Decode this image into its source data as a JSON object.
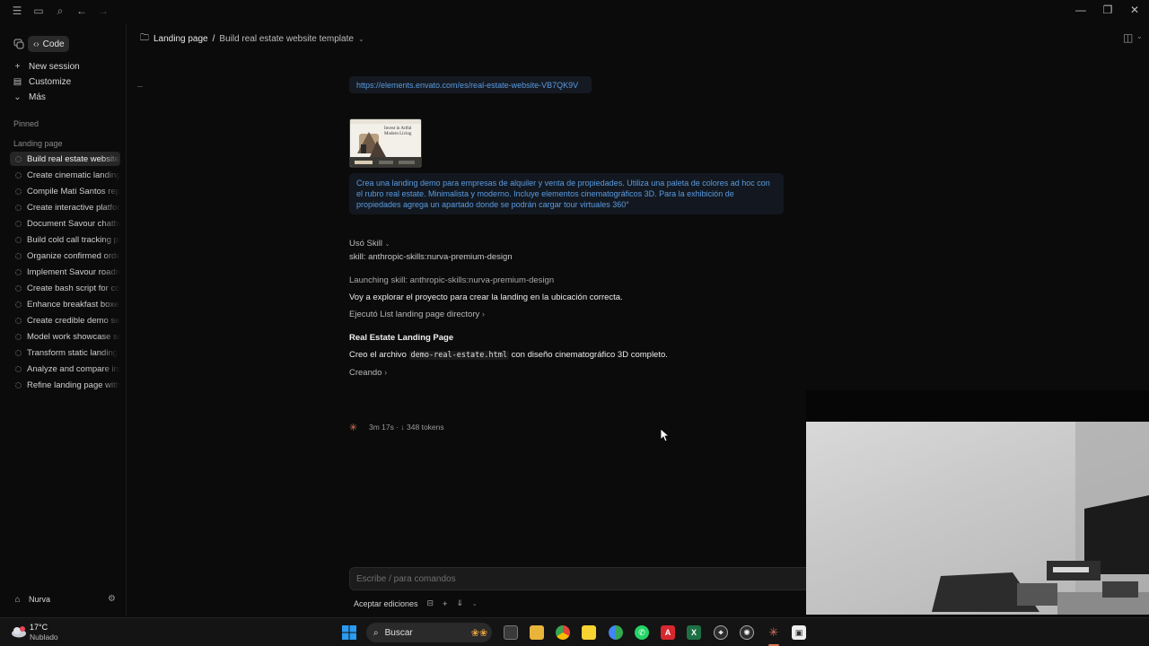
{
  "sidebar": {
    "code_label": "Code",
    "actions": [
      {
        "label": "New session",
        "icon": "plus-icon"
      },
      {
        "label": "Customize",
        "icon": "briefcase-icon"
      },
      {
        "label": "Más",
        "icon": "chevron-down-icon"
      }
    ],
    "pinned_label": "Pinned",
    "project_label": "Landing page",
    "sessions": [
      "Build real estate website template",
      "Create cinematic landing page",
      "Compile Mati Santos report",
      "Create interactive platform",
      "Document Savour chatbot",
      "Build cold call tracking page",
      "Organize confirmed orders",
      "Implement Savour roadmap",
      "Create bash script for config",
      "Enhance breakfast boxes",
      "Create credible demo section",
      "Model work showcase section",
      "Transform static landing",
      "Analyze and compare instances",
      "Refine landing page with"
    ],
    "user": "Nurva"
  },
  "header": {
    "project": "Landing page",
    "separator": "/",
    "session_title": "Build real estate website template"
  },
  "chat": {
    "url": "https://elements.envato.com/es/real-estate-website-VB7QK9V",
    "thumbnail_text": "Invest in Artful Modern Living",
    "prompt": "Crea una landing demo para empresas de alquiler y venta de propiedades. Utiliza una paleta de colores ad hoc con el rubro real estate. Minimalista y moderno. Incluye elementos cinematográficos 3D.  Para la exhibición de propiedades agrega un apartado donde se podrán cargar tour virtuales 360°",
    "skill_used": "Usó Skill",
    "skill_line": "skill: anthropic-skills:nurva-premium-design",
    "launching": "Launching skill: anthropic-skills:nurva-premium-design",
    "exploring": "Voy a explorar el proyecto para crear la landing en la ubicación correcta.",
    "executed": "Ejecutó List landing page directory",
    "section_title": "Real Estate Landing Page",
    "create_prefix": "Creo el archivo",
    "create_file": "demo-real-estate.html",
    "create_suffix": "con diseño cinematográfico 3D completo.",
    "creating": "Creando",
    "status": "3m 17s · ↓ 348 tokens"
  },
  "composer": {
    "placeholder": "Escribe / para comandos",
    "accept_label": "Aceptar ediciones"
  },
  "taskbar": {
    "temperature": "17°C",
    "weather": "Nublado",
    "search_placeholder": "Buscar"
  },
  "colors": {
    "background": "#0b0b0b",
    "link_blue": "#5a9be0",
    "accent_orange": "#d97757"
  }
}
